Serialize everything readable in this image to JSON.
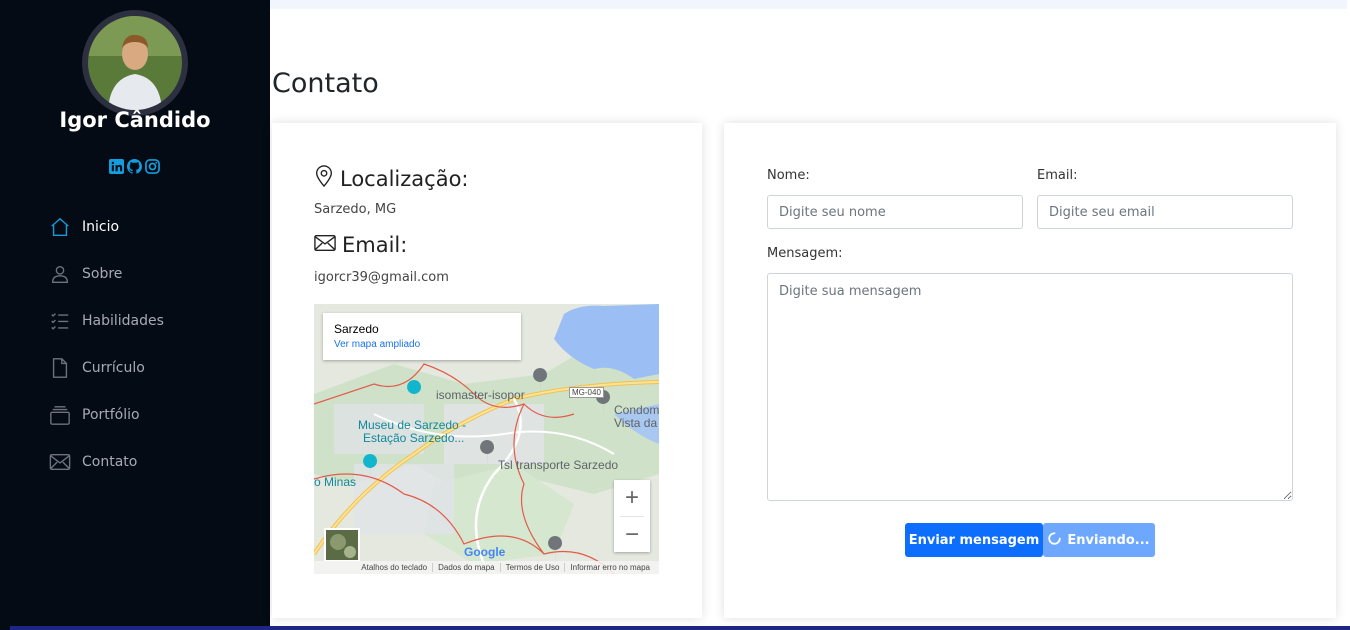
{
  "sidebar": {
    "name": "Igor Cândido",
    "socials": [
      "linkedin-icon",
      "github-icon",
      "instagram-icon"
    ],
    "nav": [
      {
        "label": "Inicio",
        "icon": "house-icon",
        "active": true
      },
      {
        "label": "Sobre",
        "icon": "person-icon"
      },
      {
        "label": "Habilidades",
        "icon": "list-check-icon"
      },
      {
        "label": "Currículo",
        "icon": "file-icon"
      },
      {
        "label": "Portfólio",
        "icon": "collection-icon"
      },
      {
        "label": "Contato",
        "icon": "envelope-icon"
      }
    ]
  },
  "page": {
    "title": "Contato"
  },
  "info": {
    "location_title": "Localização:",
    "location_value": "Sarzedo, MG",
    "email_title": "Email:",
    "email_value": "igorcr39@gmail.com"
  },
  "map": {
    "place_name": "Sarzedo",
    "enlarge_link": "Ver mapa ampliado",
    "labels": {
      "isomaster": "isomaster-isopor",
      "museu_1": "Museu de Sarzedo -",
      "museu_2": "Estação Sarzedo...",
      "tsl": "Tsl transporte Sarzedo",
      "condom_1": "Condom",
      "condom_2": "Vista da",
      "minas": "o Minas",
      "road": "MG-040",
      "google": "Google"
    },
    "zoom_in": "+",
    "zoom_out": "−",
    "footer": [
      "Atalhos do teclado",
      "Dados do mapa",
      "Termos de Uso",
      "Informar erro no mapa"
    ]
  },
  "form": {
    "name_label": "Nome:",
    "name_placeholder": "Digite seu nome",
    "email_label": "Email:",
    "email_placeholder": "Digite seu email",
    "message_label": "Mensagem:",
    "message_placeholder": "Digite sua mensagem",
    "send_button": "Enviar mensagem",
    "sending_button": "Enviando..."
  },
  "colors": {
    "sidebar_bg": "#040b14",
    "accent": "#0d6efd",
    "accent_light": "#6ea8fe",
    "social_blue": "#149ddd"
  }
}
